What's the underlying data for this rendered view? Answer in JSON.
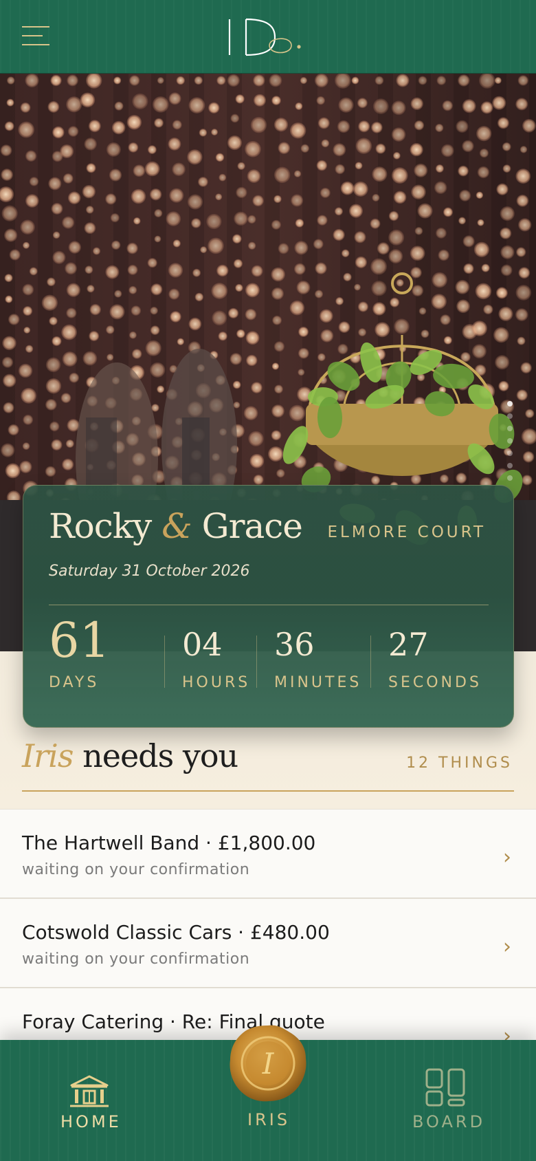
{
  "header": {
    "logo_text": "I Do.",
    "menu_icon": "hamburger-menu-icon"
  },
  "hero": {
    "slide_count": 7,
    "active_slide": 1
  },
  "countdown": {
    "partner_one": "Rocky",
    "ampersand": "&",
    "partner_two": "Grace",
    "venue": "ELMORE COURT",
    "date": "Saturday 31 October 2026",
    "days": "61",
    "days_label": "DAYS",
    "hours": "04",
    "hours_label": "HOURS",
    "minutes": "36",
    "minutes_label": "MINUTES",
    "seconds": "27",
    "seconds_label": "SECONDS"
  },
  "iris_section": {
    "name": "Iris",
    "title_rest": "needs you",
    "count_label": "12 THINGS"
  },
  "tasks": [
    {
      "title": "The Hartwell Band · £1,800.00",
      "subtitle": "waiting on your confirmation"
    },
    {
      "title": "Cotswold Classic Cars · £480.00",
      "subtitle": "waiting on your confirmation"
    },
    {
      "title": "Foray Catering · Re: Final quote",
      "subtitle": ""
    }
  ],
  "nav": {
    "home_label": "HOME",
    "iris_label": "IRIS",
    "board_label": "BOARD",
    "seal_letter": "I",
    "active": "home"
  },
  "colors": {
    "brand_green": "#1f6a50",
    "gold": "#c9a35c",
    "cream": "#f7f2e8"
  }
}
